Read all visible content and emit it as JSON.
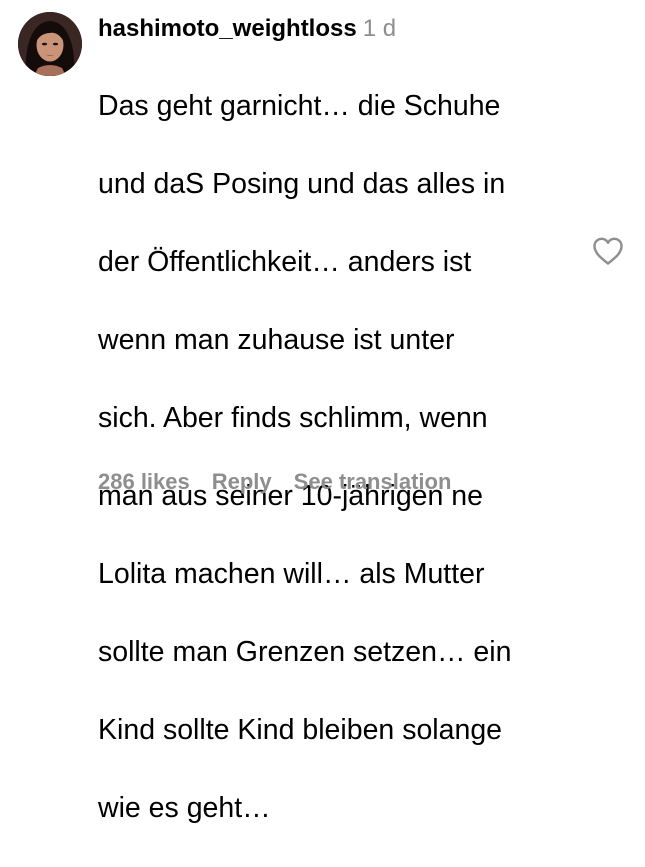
{
  "comment": {
    "username": "hashimoto_weightloss",
    "timestamp": "1 d",
    "body_lines": [
      "Das geht garnicht… die Schuhe",
      "und daS Posing und das alles in",
      "der Öffentlichkeit… anders ist",
      "wenn man zuhause ist unter",
      "sich. Aber finds schlimm, wenn",
      "man aus seiner 10-jährigen ne",
      "Lolita machen will… als Mutter",
      "sollte man Grenzen setzen… ein",
      "Kind sollte Kind bleiben solange",
      "wie es geht…"
    ],
    "likes_label": "286 likes",
    "reply_label": "Reply",
    "translate_label": "See translation",
    "avatar_icon": "user-avatar",
    "like_icon": "heart-outline-icon"
  },
  "colors": {
    "text": "#000000",
    "secondary": "#8e8e8e",
    "background": "#ffffff"
  }
}
